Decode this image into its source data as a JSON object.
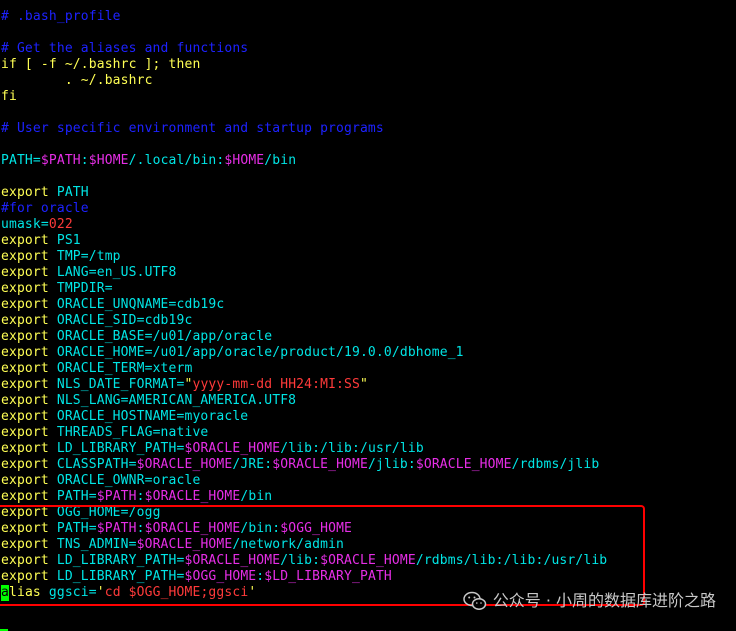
{
  "terminal": {
    "lines": [
      [
        {
          "t": "# .bash_profile",
          "c": "#1d22ff"
        }
      ],
      [
        {
          "t": "",
          "c": "#e6e6e6"
        }
      ],
      [
        {
          "t": "# Get the aliases and functions",
          "c": "#1d22ff"
        }
      ],
      [
        {
          "t": "if [ -f ~/.bashrc ]; then",
          "c": "#ffff54"
        }
      ],
      [
        {
          "t": "        . ~/.bashrc",
          "c": "#ffff54"
        }
      ],
      [
        {
          "t": "fi",
          "c": "#ffff54"
        }
      ],
      [
        {
          "t": "",
          "c": "#e6e6e6"
        }
      ],
      [
        {
          "t": "# User specific environment and startup programs",
          "c": "#1d22ff"
        }
      ],
      [
        {
          "t": "",
          "c": "#e6e6e6"
        }
      ],
      [
        {
          "t": "PATH=",
          "c": "#00e5e5"
        },
        {
          "t": "$PATH",
          "c": "#e62ee6"
        },
        {
          "t": ":",
          "c": "#00e5e5"
        },
        {
          "t": "$HOME",
          "c": "#e62ee6"
        },
        {
          "t": "/.local/bin:",
          "c": "#00e5e5"
        },
        {
          "t": "$HOME",
          "c": "#e62ee6"
        },
        {
          "t": "/bin",
          "c": "#00e5e5"
        }
      ],
      [
        {
          "t": "",
          "c": "#e6e6e6"
        }
      ],
      [
        {
          "t": "export ",
          "c": "#ffff54"
        },
        {
          "t": "PATH",
          "c": "#00e5e5"
        }
      ],
      [
        {
          "t": "#for oracle",
          "c": "#1d22ff"
        }
      ],
      [
        {
          "t": "umask=",
          "c": "#00e5e5"
        },
        {
          "t": "022",
          "c": "#ff3a3a"
        }
      ],
      [
        {
          "t": "export ",
          "c": "#ffff54"
        },
        {
          "t": "PS1",
          "c": "#00e5e5"
        }
      ],
      [
        {
          "t": "export ",
          "c": "#ffff54"
        },
        {
          "t": "TMP=/tmp",
          "c": "#00e5e5"
        }
      ],
      [
        {
          "t": "export ",
          "c": "#ffff54"
        },
        {
          "t": "LANG=en_US.UTF8",
          "c": "#00e5e5"
        }
      ],
      [
        {
          "t": "export ",
          "c": "#ffff54"
        },
        {
          "t": "TMPDIR=",
          "c": "#00e5e5"
        }
      ],
      [
        {
          "t": "export ",
          "c": "#ffff54"
        },
        {
          "t": "ORACLE_UNQNAME=cdb19c",
          "c": "#00e5e5"
        }
      ],
      [
        {
          "t": "export ",
          "c": "#ffff54"
        },
        {
          "t": "ORACLE_SID=cdb19c",
          "c": "#00e5e5"
        }
      ],
      [
        {
          "t": "export ",
          "c": "#ffff54"
        },
        {
          "t": "ORACLE_BASE=/u01/app/oracle",
          "c": "#00e5e5"
        }
      ],
      [
        {
          "t": "export ",
          "c": "#ffff54"
        },
        {
          "t": "ORACLE_HOME=/u01/app/oracle/product/19.0.0/dbhome_1",
          "c": "#00e5e5"
        }
      ],
      [
        {
          "t": "export ",
          "c": "#ffff54"
        },
        {
          "t": "ORACLE_TERM=xterm",
          "c": "#00e5e5"
        }
      ],
      [
        {
          "t": "export ",
          "c": "#ffff54"
        },
        {
          "t": "NLS_DATE_FORMAT=",
          "c": "#00e5e5"
        },
        {
          "t": "\"",
          "c": "#ffff54"
        },
        {
          "t": "yyyy-mm-dd HH24:MI:SS",
          "c": "#ff3a3a"
        },
        {
          "t": "\"",
          "c": "#ffff54"
        }
      ],
      [
        {
          "t": "export ",
          "c": "#ffff54"
        },
        {
          "t": "NLS_LANG=AMERICAN_AMERICA.UTF8",
          "c": "#00e5e5"
        }
      ],
      [
        {
          "t": "export ",
          "c": "#ffff54"
        },
        {
          "t": "ORACLE_HOSTNAME=myoracle",
          "c": "#00e5e5"
        }
      ],
      [
        {
          "t": "export ",
          "c": "#ffff54"
        },
        {
          "t": "THREADS_FLAG=native",
          "c": "#00e5e5"
        }
      ],
      [
        {
          "t": "export ",
          "c": "#ffff54"
        },
        {
          "t": "LD_LIBRARY_PATH=",
          "c": "#00e5e5"
        },
        {
          "t": "$ORACLE_HOME",
          "c": "#e62ee6"
        },
        {
          "t": "/lib:/lib:/usr/lib",
          "c": "#00e5e5"
        }
      ],
      [
        {
          "t": "export ",
          "c": "#ffff54"
        },
        {
          "t": "CLASSPATH=",
          "c": "#00e5e5"
        },
        {
          "t": "$ORACLE_HOME",
          "c": "#e62ee6"
        },
        {
          "t": "/JRE:",
          "c": "#00e5e5"
        },
        {
          "t": "$ORACLE_HOME",
          "c": "#e62ee6"
        },
        {
          "t": "/jlib:",
          "c": "#00e5e5"
        },
        {
          "t": "$ORACLE_HOME",
          "c": "#e62ee6"
        },
        {
          "t": "/rdbms/jlib",
          "c": "#00e5e5"
        }
      ],
      [
        {
          "t": "export ",
          "c": "#ffff54"
        },
        {
          "t": "ORACLE_OWNR=oracle",
          "c": "#00e5e5"
        }
      ],
      [
        {
          "t": "export ",
          "c": "#ffff54"
        },
        {
          "t": "PATH=",
          "c": "#00e5e5"
        },
        {
          "t": "$PATH",
          "c": "#e62ee6"
        },
        {
          "t": ":",
          "c": "#00e5e5"
        },
        {
          "t": "$ORACLE_HOME",
          "c": "#e62ee6"
        },
        {
          "t": "/bin",
          "c": "#00e5e5"
        }
      ],
      [
        {
          "t": "export ",
          "c": "#ffff54"
        },
        {
          "t": "OGG_HOME=/ogg",
          "c": "#00e5e5"
        }
      ],
      [
        {
          "t": "export ",
          "c": "#ffff54"
        },
        {
          "t": "PATH=",
          "c": "#00e5e5"
        },
        {
          "t": "$PATH",
          "c": "#e62ee6"
        },
        {
          "t": ":",
          "c": "#00e5e5"
        },
        {
          "t": "$ORACLE_HOME",
          "c": "#e62ee6"
        },
        {
          "t": "/bin:",
          "c": "#00e5e5"
        },
        {
          "t": "$OGG_HOME",
          "c": "#e62ee6"
        }
      ],
      [
        {
          "t": "export ",
          "c": "#ffff54"
        },
        {
          "t": "TNS_ADMIN=",
          "c": "#00e5e5"
        },
        {
          "t": "$ORACLE_HOME",
          "c": "#e62ee6"
        },
        {
          "t": "/network/admin",
          "c": "#00e5e5"
        }
      ],
      [
        {
          "t": "export ",
          "c": "#ffff54"
        },
        {
          "t": "LD_LIBRARY_PATH=",
          "c": "#00e5e5"
        },
        {
          "t": "$ORACLE_HOME",
          "c": "#e62ee6"
        },
        {
          "t": "/lib:",
          "c": "#00e5e5"
        },
        {
          "t": "$ORACLE_HOME",
          "c": "#e62ee6"
        },
        {
          "t": "/rdbms/lib:/lib:/usr/lib",
          "c": "#00e5e5"
        }
      ],
      [
        {
          "t": "export ",
          "c": "#ffff54"
        },
        {
          "t": "LD_LIBRARY_PATH=",
          "c": "#00e5e5"
        },
        {
          "t": "$OGG_HOME",
          "c": "#e62ee6"
        },
        {
          "t": ":",
          "c": "#00e5e5"
        },
        {
          "t": "$LD_LIBRARY_PATH",
          "c": "#e62ee6"
        }
      ],
      [
        {
          "t": "a",
          "c": "#000000",
          "cursor": true
        },
        {
          "t": "lias ",
          "c": "#ffff54"
        },
        {
          "t": "ggsci=",
          "c": "#00e5e5"
        },
        {
          "t": "'",
          "c": "#ffff54"
        },
        {
          "t": "cd $OGG_HOME;ggsci",
          "c": "#ff3a3a"
        },
        {
          "t": "'",
          "c": "#ffff54"
        }
      ]
    ]
  },
  "watermark": {
    "text": "公众号 · 小周的数据库进阶之路",
    "icon": "wechat-icon"
  },
  "colors": {
    "background": "#000000",
    "highlight_box": "#ff0000",
    "cursor": "#00ff00"
  }
}
